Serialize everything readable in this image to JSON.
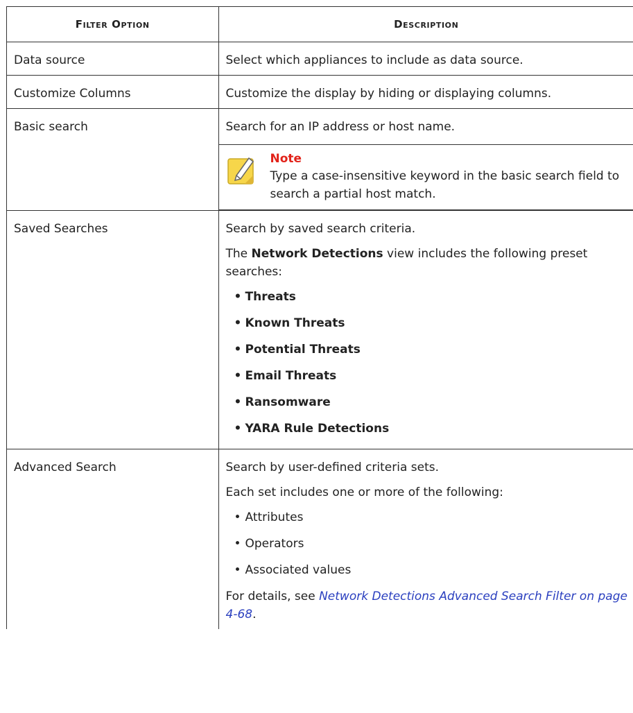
{
  "table": {
    "headers": [
      "Filter Option",
      "Description"
    ],
    "rows": {
      "data_source": {
        "option": "Data source",
        "description": "Select which appliances to include as data source."
      },
      "customize_columns": {
        "option": "Customize Columns",
        "description": "Customize the display by hiding or displaying columns."
      },
      "basic_search": {
        "option": "Basic search",
        "description": "Search for an IP address or host name.",
        "note": {
          "title": "Note",
          "body": "Type a case-insensitive keyword in the basic search field to search a partial host match.",
          "icon": "note-pencil-icon"
        }
      },
      "saved_searches": {
        "option": "Saved Searches",
        "description": "Search by saved search criteria.",
        "intro_prefix": "The ",
        "intro_bold": "Network Detections",
        "intro_suffix": " view includes the following preset searches:",
        "items": [
          "Threats",
          "Known Threats",
          "Potential Threats",
          "Email Threats",
          "Ransomware",
          "YARA Rule Detections"
        ]
      },
      "advanced_search": {
        "option": "Advanced Search",
        "description": "Search by user-defined criteria sets.",
        "intro": "Each set includes one or more of the following:",
        "items": [
          "Attributes",
          "Operators",
          "Associated values"
        ],
        "details_prefix": "For details, see ",
        "details_link": "Network Detections Advanced Search Filter on page 4-68",
        "details_suffix": "."
      }
    }
  },
  "colors": {
    "note_title": "#e2231a",
    "link": "#2a3fbf",
    "border": "#333333"
  }
}
